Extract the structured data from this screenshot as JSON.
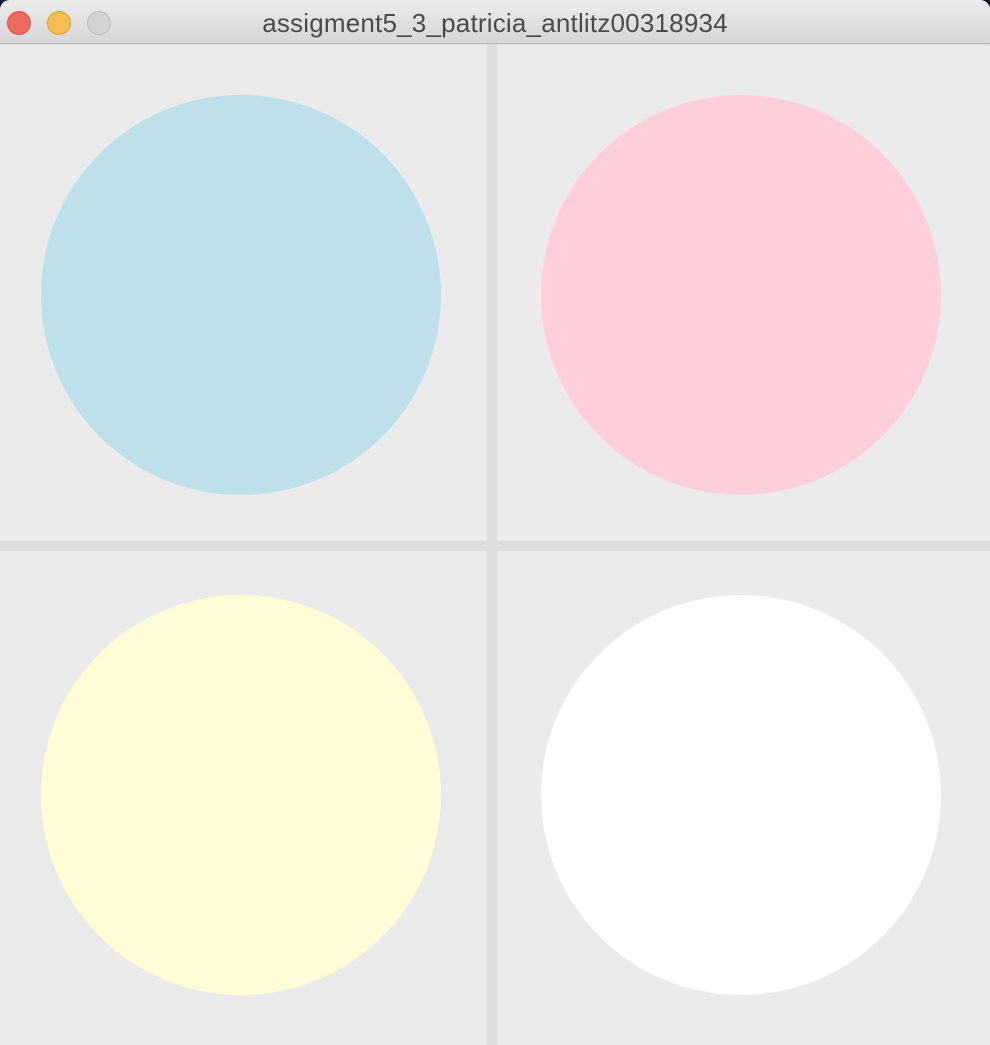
{
  "window": {
    "title": "assigment5_3_patricia_antlitz00318934",
    "controls": [
      "close-icon",
      "minimize-icon",
      "zoom-icon"
    ]
  },
  "circles": [
    {
      "name": "top-left",
      "color": "#bde0ea"
    },
    {
      "name": "top-right",
      "color": "#ffd0dc"
    },
    {
      "name": "bottom-left",
      "color": "#fffdd6"
    },
    {
      "name": "bottom-right",
      "color": "#ffffff"
    }
  ]
}
